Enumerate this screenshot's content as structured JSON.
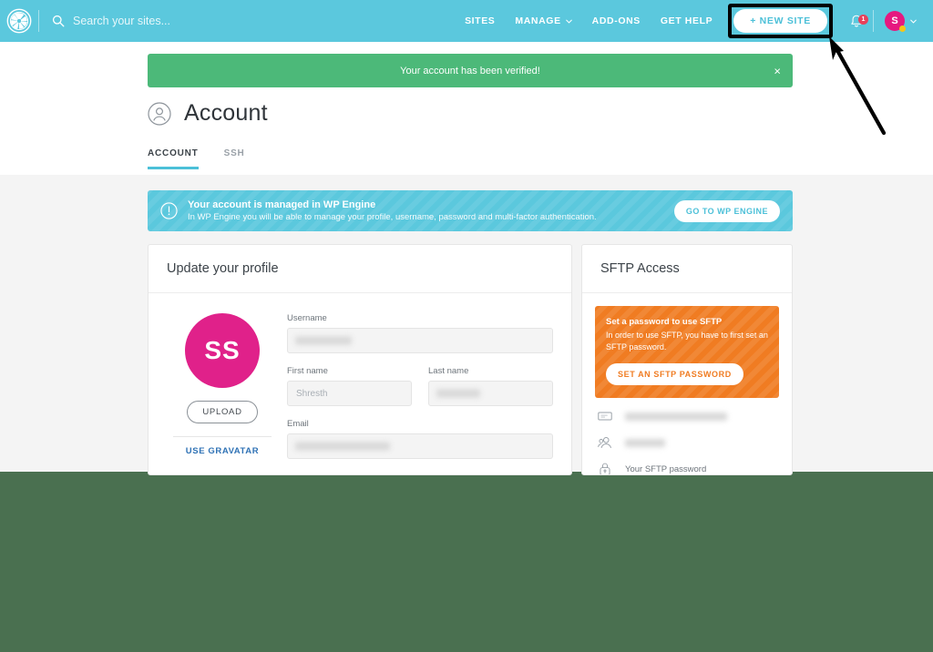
{
  "header": {
    "logo_icon": "pinwheel-logo-icon",
    "search": {
      "placeholder": "Search your sites...",
      "value": "",
      "icon": "search-icon"
    },
    "nav": [
      {
        "label": "SITES",
        "has_caret": false
      },
      {
        "label": "MANAGE",
        "has_caret": true
      },
      {
        "label": "ADD-ONS",
        "has_caret": false
      },
      {
        "label": "GET HELP",
        "has_caret": false
      }
    ],
    "new_site_button": "+ NEW SITE",
    "notifications": {
      "icon": "bell-icon",
      "count": "1"
    },
    "avatar": {
      "initial": "S",
      "icon": "chevron-down-icon"
    }
  },
  "success_banner": {
    "message": "Your account has been verified!",
    "close": "×",
    "color": "#4cb979"
  },
  "page": {
    "title": "Account",
    "title_icon": "user-circle-icon",
    "tabs": [
      {
        "label": "ACCOUNT",
        "active": true
      },
      {
        "label": "SSH",
        "active": false
      }
    ]
  },
  "info_banner": {
    "icon": "exclamation-circle-icon",
    "title": "Your account is managed in WP Engine",
    "subtitle": "In WP Engine you will be able to manage your profile, username, password and multi-factor authentication.",
    "button": "GO TO WP ENGINE",
    "color": "#5bc8dd"
  },
  "profile_card": {
    "title": "Update your profile",
    "avatar_initials": "SS",
    "avatar_color": "#e0218a",
    "upload_button": "UPLOAD",
    "gravatar_link": "USE GRAVATAR",
    "fields": [
      {
        "label": "Username",
        "value": "",
        "placeholder": "",
        "redacted": true,
        "redacted_width": 62
      },
      {
        "label": "First name",
        "value": "",
        "placeholder": "Shresth",
        "redacted": false,
        "redacted_width": 0
      },
      {
        "label": "Last name",
        "value": "",
        "placeholder": "",
        "redacted": true,
        "redacted_width": 48
      },
      {
        "label": "Email",
        "value": "",
        "placeholder": "",
        "redacted": true,
        "redacted_width": 104
      }
    ]
  },
  "sftp_card": {
    "title": "SFTP Access",
    "notice": {
      "title": "Set a password to use SFTP",
      "subtitle": "In order to use SFTP, you have to first set an SFTP password.",
      "button": "SET AN SFTP PASSWORD",
      "color": "#f07c22"
    },
    "rows": [
      {
        "icon": "server-host-icon",
        "value": "",
        "redacted": true,
        "redacted_width": 112,
        "text": ""
      },
      {
        "icon": "users-icon",
        "value": "",
        "redacted": true,
        "redacted_width": 44,
        "text": ""
      },
      {
        "icon": "lock-icon",
        "value": "",
        "redacted": false,
        "redacted_width": 0,
        "text": "Your SFTP password"
      }
    ]
  },
  "annotation": {
    "arrow": "black-arrow-pointing-to-new-site-button"
  },
  "colors": {
    "brand_cyan": "#5bc8dd",
    "success_green": "#4cb979",
    "orange": "#f07c22",
    "pink": "#e0218a",
    "bottom_band": "#4a7050"
  }
}
